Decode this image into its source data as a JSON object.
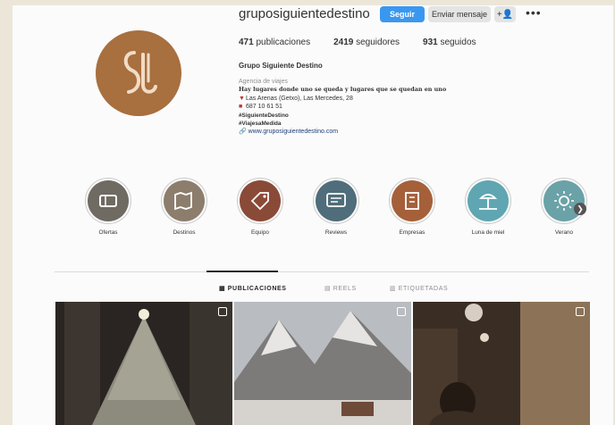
{
  "profile": {
    "username": "gruposiguientedestino",
    "follow_label": "Seguir",
    "message_label": "Enviar mensaje",
    "user_icon_label": "+👤",
    "more_label": "•••",
    "stats": {
      "posts": "471",
      "posts_label": "publicaciones",
      "followers": "2419",
      "followers_label": "seguidores",
      "following": "931",
      "following_label": "seguidos"
    },
    "full_name": "Grupo Siguiente Destino",
    "category": "Agencia de viajes",
    "bio_line": "Hay lugares donde uno se queda y lugares que se quedan en uno",
    "address": "Las Arenas (Getxo), Las Mercedes, 28",
    "phone": "687 10 61 51",
    "hashtag1": "#SiguienteDestino",
    "hashtag2": "#ViajesaMedida",
    "website": "www.gruposiguientedestino.com"
  },
  "highlights": [
    {
      "label": "Ofertas",
      "color": "#6f6a62",
      "icon": "ticket-icon"
    },
    {
      "label": "Destinos",
      "color": "#8c7d6c",
      "icon": "map-icon"
    },
    {
      "label": "Equipo",
      "color": "#8a4a38",
      "icon": "tag-icon"
    },
    {
      "label": "Reviews",
      "color": "#4f6d7a",
      "icon": "review-icon"
    },
    {
      "label": "Empresas",
      "color": "#a5603a",
      "icon": "building-icon"
    },
    {
      "label": "Luna de miel",
      "color": "#5fa6b2",
      "icon": "beach-icon"
    },
    {
      "label": "Verano",
      "color": "#6aa2a8",
      "icon": "sun-icon"
    }
  ],
  "tabs": [
    {
      "label": "PUBLICACIONES",
      "icon": "grid-icon",
      "active": true
    },
    {
      "label": "REELS",
      "icon": "reels-icon",
      "active": false
    },
    {
      "label": "ETIQUETADAS",
      "icon": "tagged-icon",
      "active": false
    }
  ],
  "posts": [
    {
      "name": "christmas-tree-post",
      "badge": "multi-image-icon"
    },
    {
      "name": "snowy-mountain-post",
      "badge": "reel-icon"
    },
    {
      "name": "christmas-market-post",
      "badge": "multi-image-icon"
    }
  ],
  "colors": {
    "brand": "#a86f3f",
    "follow_button": "#3a97f0",
    "secondary_button": "#e4e4e4",
    "link": "#1e3f7a"
  }
}
